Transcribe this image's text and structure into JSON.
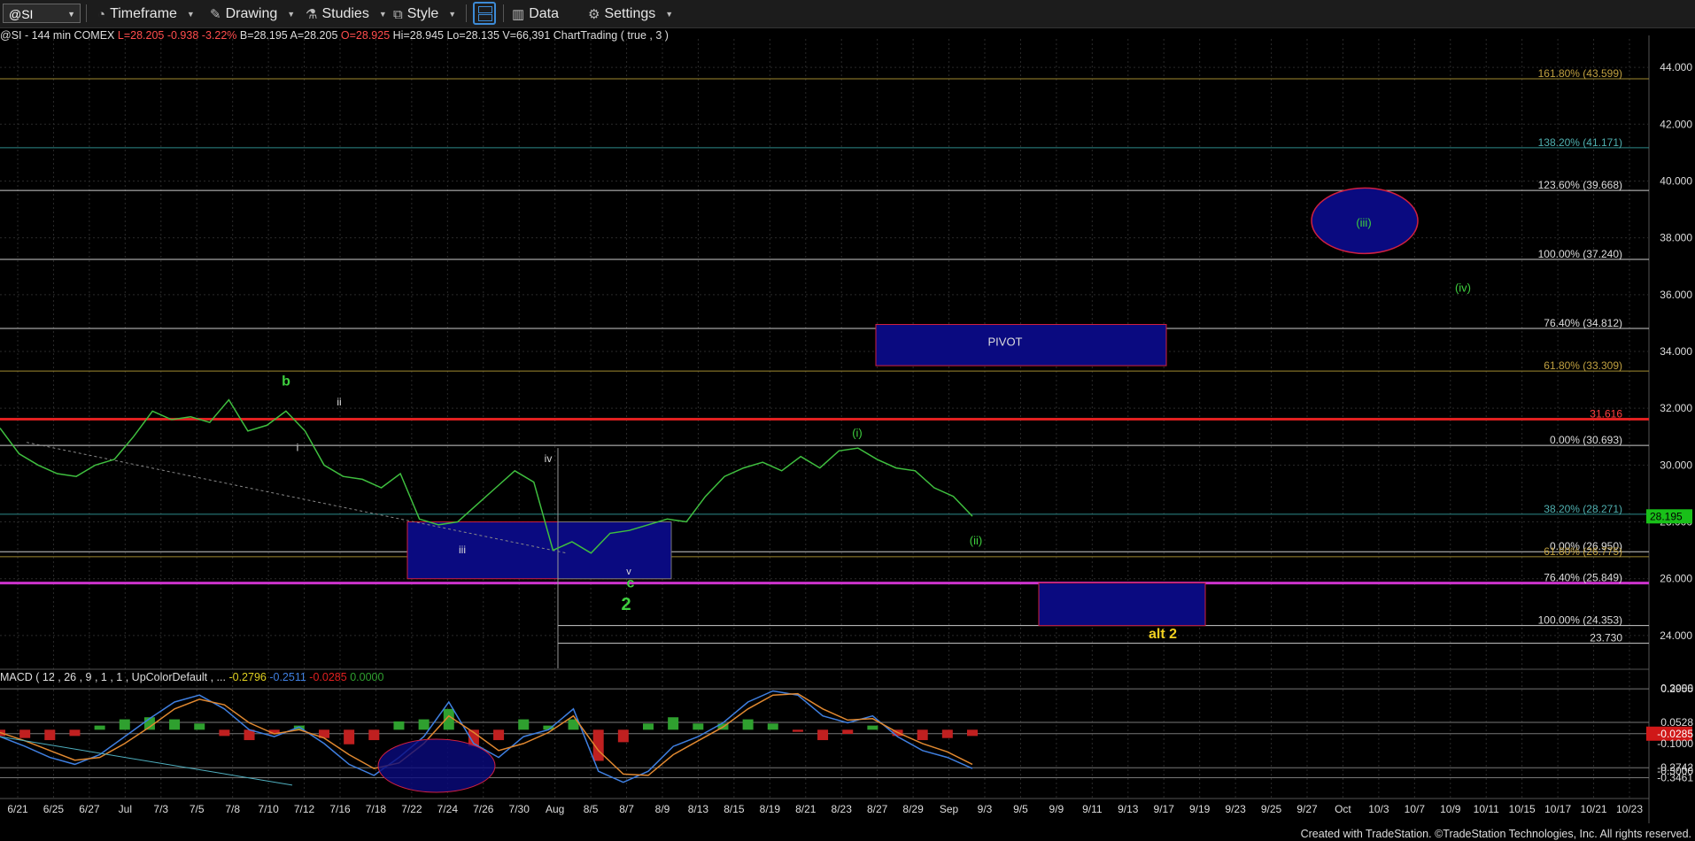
{
  "toolbar": {
    "symbol": "@SI",
    "timeframe": "Timeframe",
    "drawing": "Drawing",
    "studies": "Studies",
    "style": "Style",
    "data": "Data",
    "settings": "Settings"
  },
  "info": {
    "symbol_desc": "@SI - 144 min  COMEX",
    "last": "L=28.205",
    "change": "-0.938",
    "pct": "-3.22%",
    "open": "O=28.925",
    "bid": "B=28.195",
    "ask": "A=28.205",
    "high": "Hi=28.945",
    "low": "Lo=28.135",
    "volume": "V=66,391",
    "study": "ChartTrading ( true , 3 )"
  },
  "macd": {
    "label": "MACD ( 12 , 26 , 9 , 1 , 1 , UpColorDefault , ...",
    "macd_value": "-0.2796",
    "signal_value": "-0.2511",
    "hist_value": "-0.0285",
    "zero_value": "0.0000"
  },
  "footer": "Created with TradeStation. ©TradeStation Technologies, Inc. All rights reserved.",
  "colors": {
    "background": "#000000",
    "price_line": "#3fbf3f",
    "pivot_fill": "#0a0a80",
    "pivot_border": "#d02040",
    "red_line": "#e02020",
    "magenta_line": "#cc33cc",
    "macd_line": "#3f7fe0",
    "signal_line": "#e08830",
    "hist_up": "#2fa02f",
    "hist_down": "#c02020"
  },
  "chart_data": {
    "type": "line",
    "price_axis": {
      "ylim": [
        23.0,
        45.0
      ],
      "ticks": [
        "44.000",
        "42.000",
        "40.000",
        "38.000",
        "36.000",
        "34.000",
        "32.000",
        "30.000",
        "28.000",
        "26.000",
        "24.000"
      ],
      "last_price": "28.195"
    },
    "x_axis": {
      "labels": [
        "6/21",
        "6/25",
        "6/27",
        "Jul",
        "7/3",
        "7/5",
        "7/8",
        "7/10",
        "7/12",
        "7/16",
        "7/18",
        "7/22",
        "7/24",
        "7/26",
        "7/30",
        "Aug",
        "8/5",
        "8/7",
        "8/9",
        "8/13",
        "8/15",
        "8/19",
        "8/21",
        "8/23",
        "8/27",
        "8/29",
        "Sep",
        "9/3",
        "9/5",
        "9/9",
        "9/11",
        "9/13",
        "9/17",
        "9/19",
        "9/23",
        "9/25",
        "9/27",
        "Oct",
        "10/3",
        "10/7",
        "10/9",
        "10/11",
        "10/15",
        "10/17",
        "10/21",
        "10/23"
      ]
    },
    "series": [
      {
        "type": "line",
        "points": [
          [
            "6/21",
            31.3
          ],
          [
            "6/24",
            30.4
          ],
          [
            "6/25",
            30.0
          ],
          [
            "6/26",
            29.7
          ],
          [
            "6/27",
            29.6
          ],
          [
            "7/1",
            30.0
          ],
          [
            "7/2",
            30.2
          ],
          [
            "7/3",
            31.0
          ],
          [
            "7/5",
            31.9
          ],
          [
            "7/8",
            31.6
          ],
          [
            "7/9",
            31.7
          ],
          [
            "7/10",
            31.5
          ],
          [
            "7/11",
            32.3
          ],
          [
            "7/12",
            31.2
          ],
          [
            "7/15",
            31.4
          ],
          [
            "7/16",
            31.9
          ],
          [
            "7/17",
            31.2
          ],
          [
            "7/18",
            30.0
          ],
          [
            "7/19",
            29.6
          ],
          [
            "7/22",
            29.5
          ],
          [
            "7/23",
            29.2
          ],
          [
            "7/24",
            29.7
          ],
          [
            "7/25",
            28.1
          ],
          [
            "7/26",
            27.9
          ],
          [
            "7/29",
            28.0
          ],
          [
            "7/30",
            28.6
          ],
          [
            "7/31",
            29.2
          ],
          [
            "Aug",
            29.8
          ],
          [
            "8/2",
            29.4
          ],
          [
            "8/5",
            27.0
          ],
          [
            "8/6",
            27.3
          ],
          [
            "8/7",
            26.9
          ],
          [
            "8/8",
            27.6
          ],
          [
            "8/9",
            27.7
          ],
          [
            "8/12",
            27.9
          ],
          [
            "8/13",
            28.1
          ],
          [
            "8/14",
            28.0
          ],
          [
            "8/15",
            28.9
          ],
          [
            "8/16",
            29.6
          ],
          [
            "8/19",
            29.9
          ],
          [
            "8/20",
            30.1
          ],
          [
            "8/21",
            29.8
          ],
          [
            "8/22",
            30.3
          ],
          [
            "8/23",
            29.9
          ],
          [
            "8/26",
            30.5
          ],
          [
            "8/27",
            30.6
          ],
          [
            "8/28",
            30.2
          ],
          [
            "8/29",
            29.9
          ],
          [
            "8/30",
            29.8
          ],
          [
            "Sep",
            29.2
          ],
          [
            "9/3",
            28.9
          ],
          [
            "9/4",
            28.2
          ]
        ]
      }
    ],
    "annotations": [
      {
        "text": "b"
      },
      {
        "text": "ii"
      },
      {
        "text": "i"
      },
      {
        "text": "iv"
      },
      {
        "text": "iii"
      },
      {
        "text": "v"
      },
      {
        "text": "c"
      },
      {
        "text": "2"
      },
      {
        "text": "(i)"
      },
      {
        "text": "(ii)"
      },
      {
        "text": "(iii)"
      },
      {
        "text": "(iv)"
      },
      {
        "text": "PIVOT"
      },
      {
        "text": "alt 2"
      }
    ],
    "fib_levels": [
      {
        "label": "161.80% (43.599)",
        "value": 43.599
      },
      {
        "label": "138.20% (41.171)",
        "value": 41.171
      },
      {
        "label": "123.60% (39.668)",
        "value": 39.668
      },
      {
        "label": "100.00% (37.240)",
        "value": 37.24
      },
      {
        "label": "76.40% (34.812)",
        "value": 34.812
      },
      {
        "label": "61.80% (33.309)",
        "value": 33.309
      },
      {
        "label": "31.616",
        "value": 31.616
      },
      {
        "label": "0.00% (30.693)",
        "value": 30.693
      },
      {
        "label": "38.20% (28.271)",
        "value": 28.271
      },
      {
        "label": "0.00% (26.950)",
        "value": 26.95
      },
      {
        "label": "61.80% (26.775)",
        "value": 26.775
      },
      {
        "label": "76.40% (25.849)",
        "value": 25.849
      },
      {
        "label": "100.00% (24.353)",
        "value": 24.353
      },
      {
        "label": "23.730",
        "value": 23.73
      }
    ],
    "macd_panel": {
      "ylim": [
        -0.42,
        0.36
      ],
      "ticks": [
        "0.2955",
        "0.3000",
        "0.0528",
        "-0.0285",
        "-0.1000",
        "-0.2742",
        "-0.3461",
        "-0.3000"
      ],
      "macd": [
        -0.05,
        -0.12,
        -0.2,
        -0.25,
        -0.18,
        -0.05,
        0.08,
        0.2,
        0.25,
        0.15,
        0.0,
        -0.05,
        0.02,
        -0.1,
        -0.25,
        -0.33,
        -0.2,
        -0.05,
        0.2,
        -0.1,
        -0.2,
        -0.05,
        0.0,
        0.15,
        -0.3,
        -0.38,
        -0.3,
        -0.12,
        -0.05,
        0.05,
        0.2,
        0.28,
        0.25,
        0.1,
        0.05,
        0.1,
        -0.05,
        -0.15,
        -0.2,
        -0.28
      ],
      "signal": [
        -0.02,
        -0.08,
        -0.15,
        -0.22,
        -0.2,
        -0.1,
        0.02,
        0.15,
        0.22,
        0.18,
        0.05,
        -0.03,
        0.0,
        -0.06,
        -0.18,
        -0.28,
        -0.24,
        -0.1,
        0.1,
        -0.02,
        -0.15,
        -0.1,
        -0.02,
        0.1,
        -0.15,
        -0.32,
        -0.33,
        -0.18,
        -0.08,
        0.02,
        0.15,
        0.25,
        0.26,
        0.15,
        0.07,
        0.08,
        -0.02,
        -0.1,
        -0.16,
        -0.25
      ]
    }
  }
}
